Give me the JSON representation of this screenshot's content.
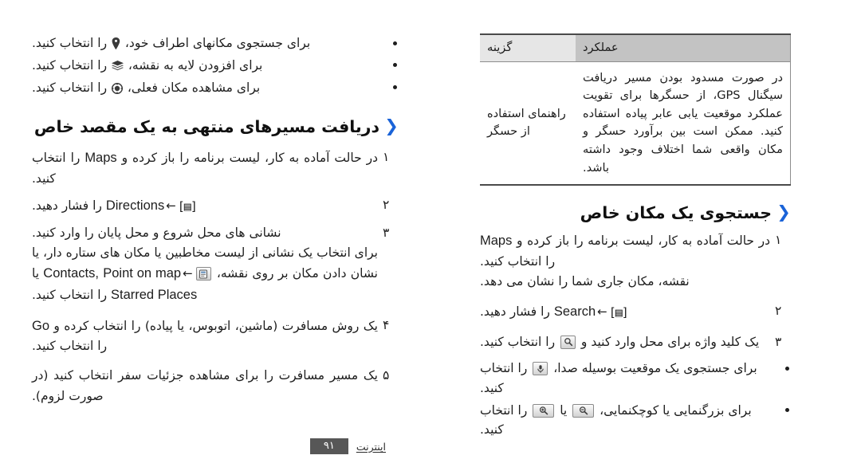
{
  "document": {
    "language": "fa",
    "footer": {
      "section_label": "اینترنت",
      "page_number": "۹۱"
    },
    "accent_color": "#1a63d8",
    "page_box_color": "#575757"
  },
  "left_page": {
    "top_bullets": [
      {
        "text_before": "برای جستجوی مکانهای اطراف خود، ",
        "icon": "map-pin-icon",
        "text_after": " را انتخاب کنید."
      },
      {
        "text_before": "برای افزودن لایه به نقشه، ",
        "icon": "layers-icon",
        "text_after": " را انتخاب کنید."
      },
      {
        "text_before": "برای مشاهده مکان فعلی، ",
        "icon": "my-location-icon",
        "text_after": " را انتخاب کنید."
      }
    ],
    "heading": "دریافت مسیرهای منتهی به یک مقصد خاص",
    "steps": [
      {
        "number": "۱",
        "segments": [
          {
            "type": "text",
            "value": "در حالت آماده به کار، لیست برنامه را باز کرده و "
          },
          {
            "type": "latin",
            "value": "Maps"
          },
          {
            "type": "text",
            "value": " را انتخاب کنید."
          }
        ]
      },
      {
        "number": "۲",
        "segments": [
          {
            "type": "menukey",
            "value": "[▤]"
          },
          {
            "type": "arrow",
            "value": "←"
          },
          {
            "type": "latin",
            "value": "Directions"
          },
          {
            "type": "text",
            "value": " را فشار دهید."
          }
        ]
      },
      {
        "number": "۳",
        "segments": [
          {
            "type": "text",
            "value": "نشانی های محل شروع و محل پایان را وارد کنید."
          }
        ],
        "sub_segments": [
          {
            "type": "text",
            "value": "برای انتخاب یک نشانی از لیست مخاطبین یا مکان های ستاره دار، یا نشان دادن مکان بر روی نقشه، "
          },
          {
            "type": "chip",
            "value": "contacts-chip-icon"
          },
          {
            "type": "arrow",
            "value": "←"
          },
          {
            "type": "latin",
            "value": "Contacts,"
          },
          {
            "type": "latin",
            "value": "Point on map"
          },
          {
            "type": "text",
            "value": " یا "
          },
          {
            "type": "latin",
            "value": "Starred Places"
          },
          {
            "type": "text",
            "value": " را انتخاب کنید."
          }
        ]
      },
      {
        "number": "۴",
        "segments": [
          {
            "type": "text",
            "value": "یک روش مسافرت (ماشین، اتوبوس، یا پیاده) را انتخاب کرده و "
          },
          {
            "type": "latin",
            "value": "Go"
          },
          {
            "type": "text",
            "value": " را انتخاب کنید."
          }
        ]
      },
      {
        "number": "۵",
        "segments": [
          {
            "type": "text",
            "value": "یک مسیر مسافرت را برای مشاهده جزئیات سفر انتخاب کنید (در صورت لزوم)."
          }
        ]
      }
    ]
  },
  "right_page": {
    "table": {
      "headers": {
        "option": "گزینه",
        "function": "عملکرد"
      },
      "rows": [
        {
          "option": "راهنمای استفاده از حسگر",
          "function": "در صورت مسدود بودن مسیر دریافت سیگنال GPS، از حسگرها برای تقویت عملکرد موقعیت یابی عابر پیاده استفاده کنید. ممکن است بین برآورد حسگر و مکان واقعی شما اختلاف وجود داشته باشد."
        }
      ],
      "header_option_bg": "#e6e6e6",
      "header_function_bg": "#c3c3c3"
    },
    "heading": "جستجوی یک مکان خاص",
    "steps": [
      {
        "number": "۱",
        "segments": [
          {
            "type": "text",
            "value": "در حالت آماده به کار، لیست برنامه را باز کرده و "
          },
          {
            "type": "latin",
            "value": "Maps"
          },
          {
            "type": "text",
            "value": " را انتخاب کنید."
          }
        ],
        "sub_text": "نقشه، مکان جاری شما را نشان می دهد."
      },
      {
        "number": "۲",
        "segments": [
          {
            "type": "menukey",
            "value": "[▤]"
          },
          {
            "type": "arrow",
            "value": "←"
          },
          {
            "type": "latin",
            "value": "Search"
          },
          {
            "type": "text",
            "value": " را فشار دهید."
          }
        ]
      },
      {
        "number": "۳",
        "segments": [
          {
            "type": "text",
            "value": "یک کلید واژه برای محل وارد کنید و "
          },
          {
            "type": "chip",
            "value": "search-chip-icon"
          },
          {
            "type": "text",
            "value": " را انتخاب کنید."
          }
        ]
      }
    ],
    "bullets": [
      {
        "text_before": "برای جستجوی یک موقعیت بوسیله صدا، ",
        "icon": "microphone-chip-icon",
        "text_after": " را انتخاب کنید."
      },
      {
        "text_before": "برای بزرگنمایی یا کوچکنمایی، ",
        "icon": "zoom-out-chip-icon",
        "middle": " یا ",
        "icon2": "zoom-in-chip-icon",
        "text_after": " را انتخاب کنید."
      }
    ]
  }
}
